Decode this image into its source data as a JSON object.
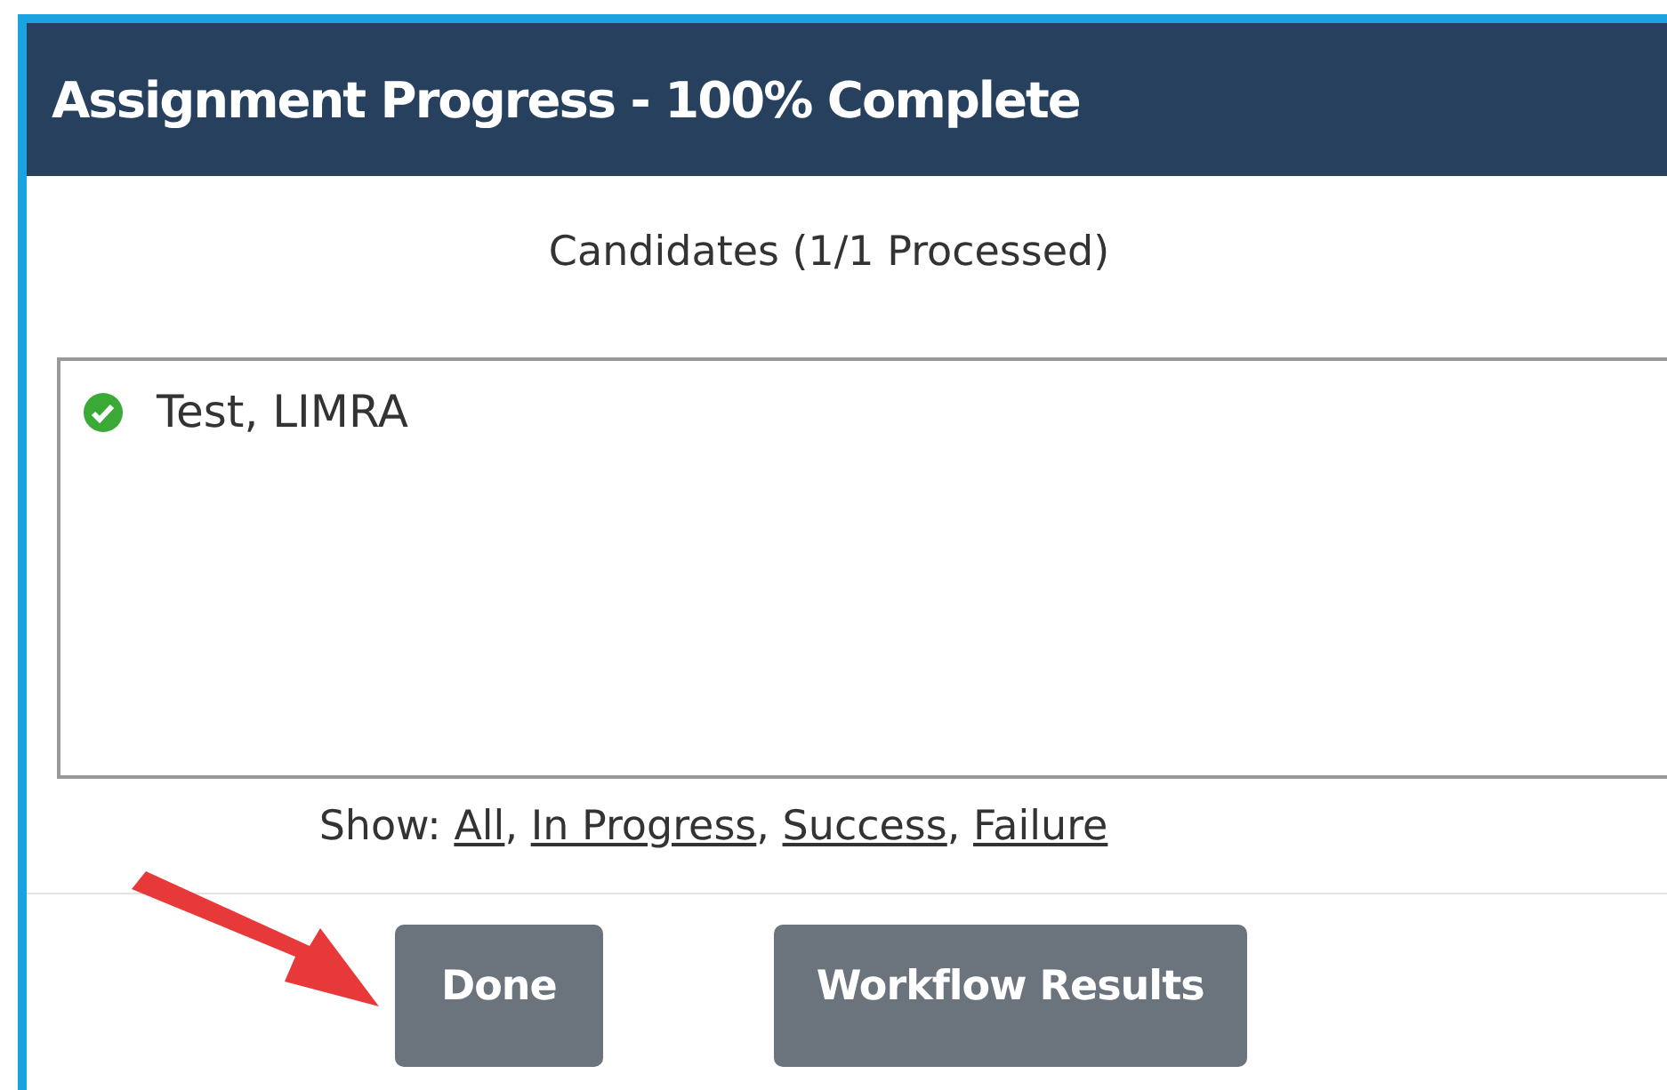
{
  "dialog": {
    "title": "Assignment Progress - 100% Complete"
  },
  "candidates": {
    "heading": "Candidates (1/1 Processed)",
    "items": [
      {
        "name": "Test, LIMRA",
        "succeeded": true
      }
    ]
  },
  "filter": {
    "label": "Show:",
    "separator": ",",
    "options": [
      {
        "label": "All"
      },
      {
        "label": "In Progress"
      },
      {
        "label": "Success"
      },
      {
        "label": "Failure"
      }
    ]
  },
  "buttons": [
    {
      "label": "Done"
    },
    {
      "label": "Workflow Results"
    }
  ]
}
